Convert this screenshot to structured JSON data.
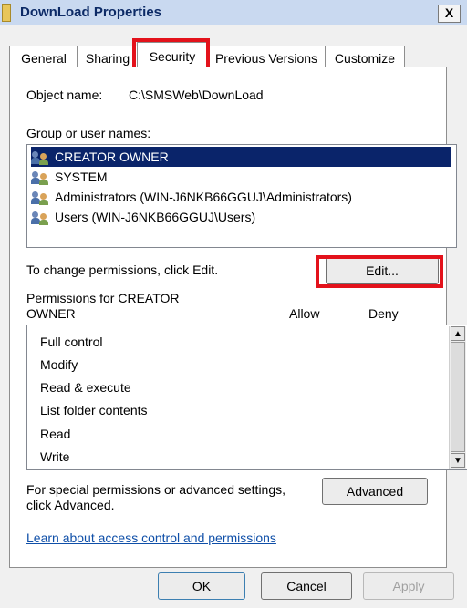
{
  "window": {
    "title": "DownLoad Properties",
    "close_label": "X"
  },
  "tabs": [
    {
      "label": "General"
    },
    {
      "label": "Sharing"
    },
    {
      "label": "Security"
    },
    {
      "label": "Previous Versions"
    },
    {
      "label": "Customize"
    }
  ],
  "security": {
    "object_name_label": "Object name:",
    "object_name_value": "C:\\SMSWeb\\DownLoad",
    "group_label": "Group or user names:",
    "users": [
      {
        "label": "CREATOR OWNER"
      },
      {
        "label": "SYSTEM"
      },
      {
        "label": "Administrators (WIN-J6NKB66GGUJ\\Administrators)"
      },
      {
        "label": "Users (WIN-J6NKB66GGUJ\\Users)"
      }
    ],
    "change_text": "To change permissions, click Edit.",
    "edit_label": "Edit...",
    "permissions_label_line1": "Permissions for CREATOR",
    "permissions_label_line2": "OWNER",
    "allow_header": "Allow",
    "deny_header": "Deny",
    "permissions": [
      {
        "label": "Full control"
      },
      {
        "label": "Modify"
      },
      {
        "label": "Read & execute"
      },
      {
        "label": "List folder contents"
      },
      {
        "label": "Read"
      },
      {
        "label": "Write"
      }
    ],
    "special_line1": "For special permissions or advanced settings,",
    "special_line2": "click Advanced.",
    "advanced_label": "Advanced",
    "learn_link": "Learn about access control and permissions"
  },
  "buttons": {
    "ok": "OK",
    "cancel": "Cancel",
    "apply": "Apply"
  },
  "colors": {
    "highlight": "#e3121b",
    "selection": "#0a246a",
    "link": "#0f4fa8"
  }
}
